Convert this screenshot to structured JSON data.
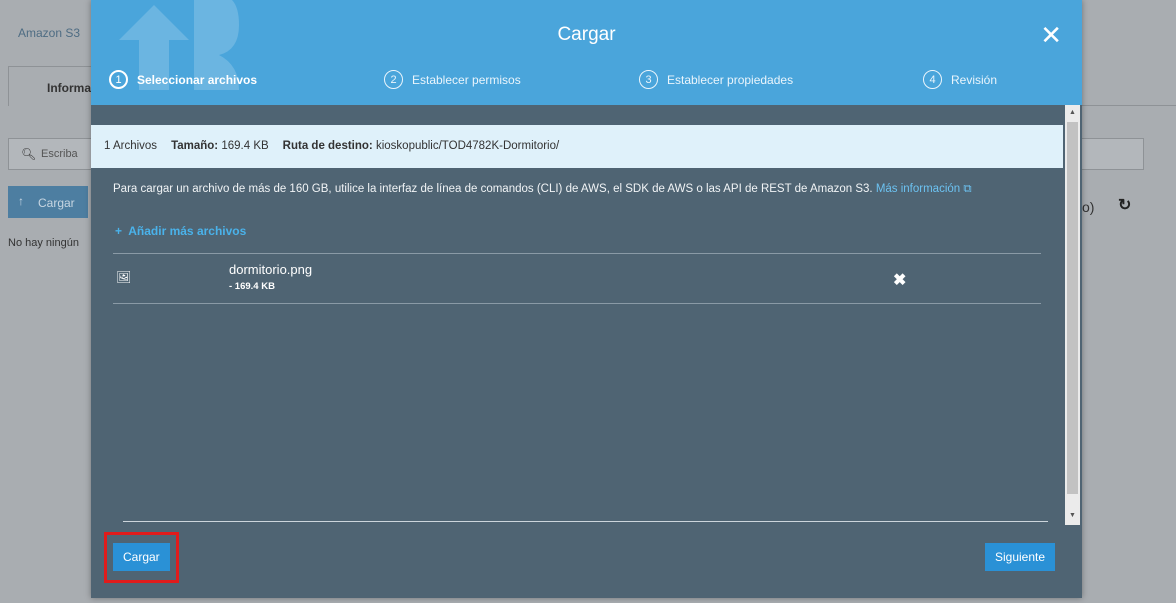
{
  "background": {
    "breadcrumb": "Amazon S3",
    "tab_label": "Informa",
    "search_placeholder": "Escriba",
    "upload_label": "Cargar",
    "no_items_text": "No hay ningún",
    "right_text": "o)"
  },
  "modal": {
    "title": "Cargar",
    "steps": [
      {
        "num": "1",
        "label": "Seleccionar archivos",
        "active": true
      },
      {
        "num": "2",
        "label": "Establecer permisos",
        "active": false
      },
      {
        "num": "3",
        "label": "Establecer propiedades",
        "active": false
      },
      {
        "num": "4",
        "label": "Revisión",
        "active": false
      }
    ],
    "info": {
      "files_count": "1 Archivos",
      "size_label": "Tamaño:",
      "size_value": "169.4 KB",
      "dest_label": "Ruta de destino:",
      "dest_value": "kioskopublic/TOD4782K-Dormitorio/"
    },
    "notice_text": "Para cargar un archivo de más de 160 GB, utilice la interfaz de línea de comandos (CLI) de AWS, el SDK de AWS o las API de REST de Amazon S3.",
    "notice_link": "Más información",
    "add_more": "Añadir más archivos",
    "file": {
      "name": "dormitorio.png",
      "size": "- 169.4 KB"
    },
    "buttons": {
      "upload": "Cargar",
      "next": "Siguiente"
    }
  },
  "colors": {
    "header": "#4aa5db",
    "body": "#4f6473",
    "info_bar": "#dff1fa",
    "button": "#2a91d6",
    "highlight": "#e01b1b"
  }
}
